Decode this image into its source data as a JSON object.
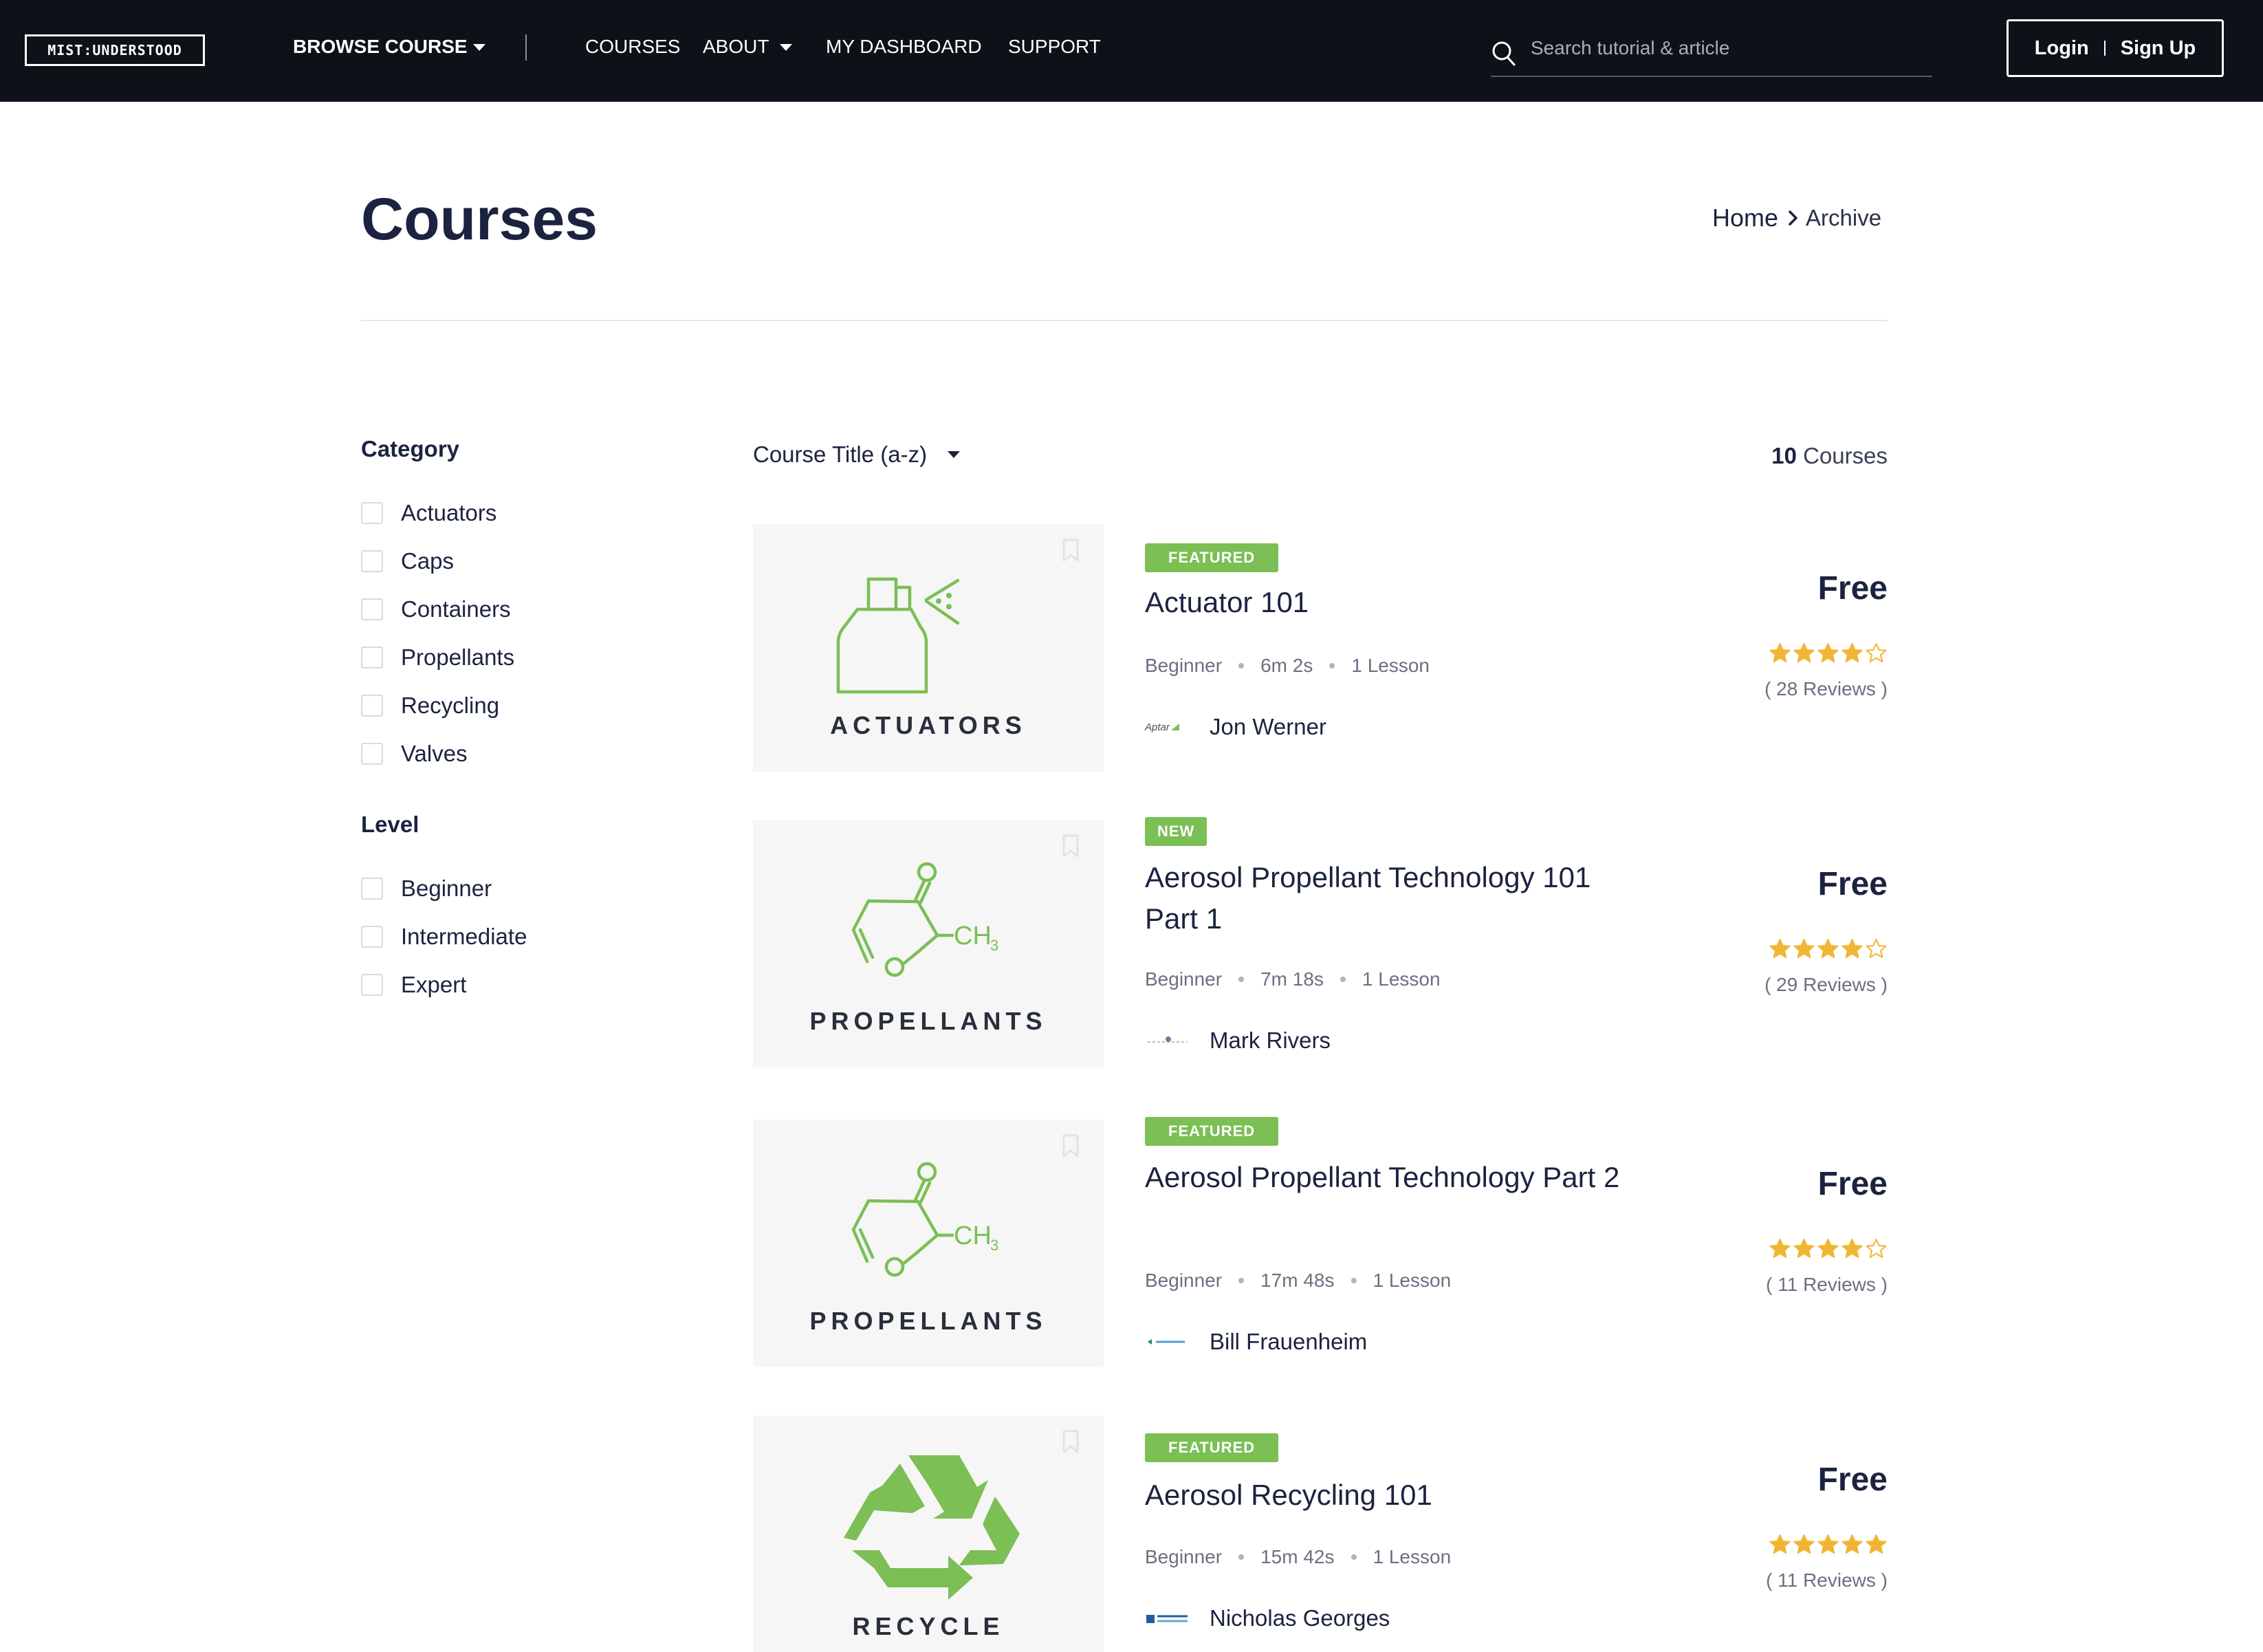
{
  "header": {
    "logo_text": "MIST:UNDERSTOOD",
    "browse_label": "BROWSE COURSE",
    "nav": {
      "courses": "COURSES",
      "about": "ABOUT",
      "dashboard": "MY DASHBOARD",
      "support": "SUPPORT"
    },
    "search_placeholder": "Search tutorial & article",
    "login_label": "Login",
    "signup_label": "Sign Up"
  },
  "page": {
    "title": "Courses",
    "breadcrumb": {
      "home": "Home",
      "current": "Archive"
    }
  },
  "filters": {
    "category_heading": "Category",
    "categories": [
      "Actuators",
      "Caps",
      "Containers",
      "Propellants",
      "Recycling",
      "Valves"
    ],
    "level_heading": "Level",
    "levels": [
      "Beginner",
      "Intermediate",
      "Expert"
    ]
  },
  "toolbar": {
    "sort_label": "Course Title (a-z)",
    "count_number": "10",
    "count_suffix": "Courses"
  },
  "colors": {
    "nav_bg": "#0e1117",
    "accent_green": "#7bbf55",
    "star_gold": "#f2b533",
    "text_dark": "#1c2340"
  },
  "courses": [
    {
      "badge": "FEATURED",
      "title": "Actuator 101",
      "level": "Beginner",
      "duration": "6m 2s",
      "lessons": "1 Lesson",
      "author": "Jon Werner",
      "author_logo_text": "Aptar",
      "price": "Free",
      "rating": 4,
      "reviews": "( 28 Reviews )",
      "thumb_label": "ACTUATORS",
      "thumb_icon": "spray-bottle-icon"
    },
    {
      "badge": "NEW",
      "title": "Aerosol Propellant Technology 101 Part 1",
      "level": "Beginner",
      "duration": "7m 18s",
      "lessons": "1 Lesson",
      "author": "Mark Rivers",
      "author_logo_text": "",
      "price": "Free",
      "rating": 4,
      "reviews": "( 29 Reviews )",
      "thumb_label": "PROPELLANTS",
      "thumb_icon": "molecule-icon"
    },
    {
      "badge": "FEATURED",
      "title": "Aerosol Propellant Technology Part 2",
      "level": "Beginner",
      "duration": "17m 48s",
      "lessons": "1 Lesson",
      "author": "Bill Frauenheim",
      "author_logo_text": "",
      "price": "Free",
      "rating": 4,
      "reviews": "( 11 Reviews )",
      "thumb_label": "PROPELLANTS",
      "thumb_icon": "molecule-icon"
    },
    {
      "badge": "FEATURED",
      "title": "Aerosol Recycling 101",
      "level": "Beginner",
      "duration": "15m 42s",
      "lessons": "1 Lesson",
      "author": "Nicholas Georges",
      "author_logo_text": "",
      "price": "Free",
      "rating": 5,
      "reviews": "( 11 Reviews )",
      "thumb_label": "RECYCLE",
      "thumb_icon": "recycle-icon"
    }
  ]
}
